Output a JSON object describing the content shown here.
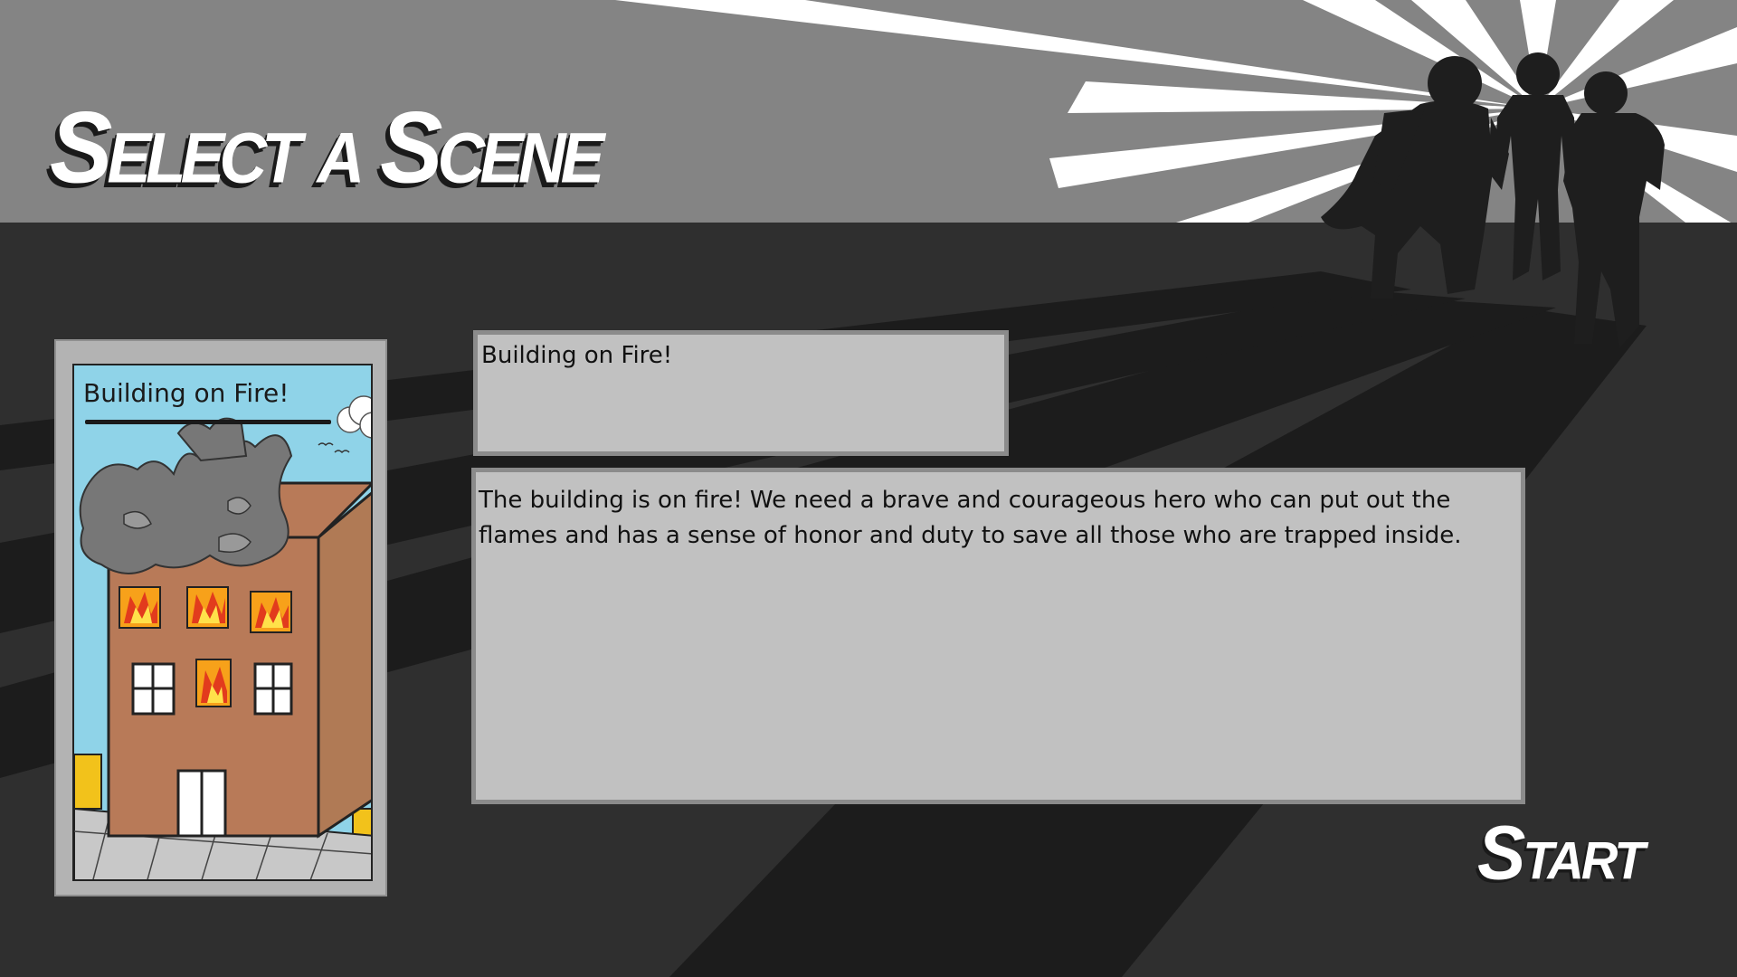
{
  "header": {
    "title": "Select a Scene"
  },
  "scene_card": {
    "title": "Building on Fire!"
  },
  "scene_name": "Building on Fire!",
  "scene_description": "The building is on fire! We need a brave and courageous hero who can put out the flames and has a sense of honor and duty to save all those who are trapped inside.",
  "actions": {
    "start_label": "Start"
  },
  "colors": {
    "banner_gray": "#848484",
    "background_dark": "#2f2f2f",
    "panel_fill": "#c1c1c1",
    "panel_border": "#8b8b8b",
    "text_white": "#ffffff",
    "silhouette": "#1e1e1e"
  }
}
